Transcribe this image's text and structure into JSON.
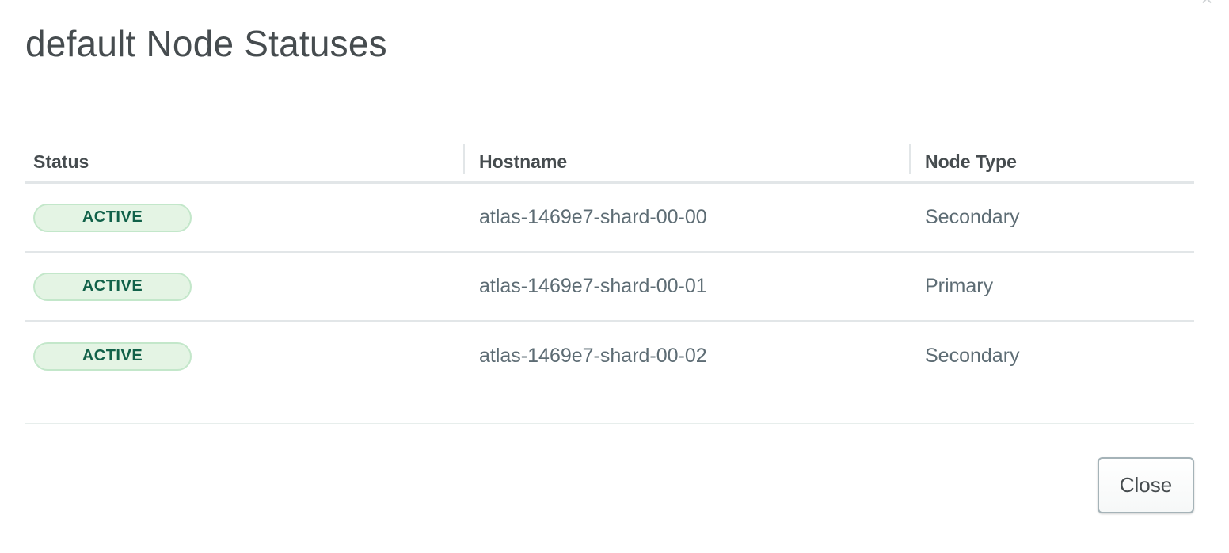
{
  "modal": {
    "title": "default Node Statuses",
    "close_icon": "close-icon"
  },
  "table": {
    "headers": {
      "status": "Status",
      "hostname": "Hostname",
      "node_type": "Node Type"
    },
    "rows": [
      {
        "status": "ACTIVE",
        "hostname": "atlas-1469e7-shard-00-00",
        "node_type": "Secondary"
      },
      {
        "status": "ACTIVE",
        "hostname": "atlas-1469e7-shard-00-01",
        "node_type": "Primary"
      },
      {
        "status": "ACTIVE",
        "hostname": "atlas-1469e7-shard-00-02",
        "node_type": "Secondary"
      }
    ]
  },
  "footer": {
    "close_label": "Close"
  },
  "colors": {
    "status_active_text": "#116149",
    "status_active_bg": "#e4f4e4",
    "status_active_border": "#c3e7ca"
  }
}
